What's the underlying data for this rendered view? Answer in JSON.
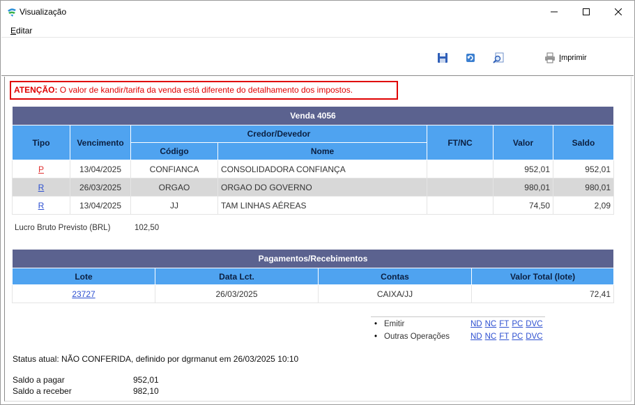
{
  "window": {
    "title": "Visualização"
  },
  "menu": {
    "edit": {
      "mnemonic": "E",
      "rest": "ditar"
    }
  },
  "toolbar": {
    "print": {
      "mnemonic": "I",
      "rest": "mprimir"
    }
  },
  "alert": {
    "bold": "ATENÇÃO:",
    "text": " O valor de kandir/tarifa da venda está diferente do detalhamento dos impostos."
  },
  "sale": {
    "title": "Venda  4056",
    "headers": {
      "tipo": "Tipo",
      "vencimento": "Vencimento",
      "credor": "Credor/Devedor",
      "codigo": "Código",
      "nome": "Nome",
      "ftnc": "FT/NC",
      "valor": "Valor",
      "saldo": "Saldo"
    },
    "rows": [
      {
        "tipo": "P",
        "vencimento": "13/04/2025",
        "codigo": "CONFIANCA",
        "nome": "CONSOLIDADORA CONFIANÇA",
        "ftnc": "",
        "valor": "952,01",
        "saldo": "952,01"
      },
      {
        "tipo": "R",
        "vencimento": "26/03/2025",
        "codigo": "ORGAO",
        "nome": "ORGAO DO GOVERNO",
        "ftnc": "",
        "valor": "980,01",
        "saldo": "980,01"
      },
      {
        "tipo": "R",
        "vencimento": "13/04/2025",
        "codigo": "JJ",
        "nome": "TAM LINHAS AÉREAS",
        "ftnc": "",
        "valor": "74,50",
        "saldo": "2,09"
      }
    ]
  },
  "lucro": {
    "label": "Lucro Bruto Previsto (BRL)",
    "value": "102,50"
  },
  "payments": {
    "title": "Pagamentos/Recebimentos",
    "headers": {
      "lote": "Lote",
      "data": "Data Lct.",
      "contas": "Contas",
      "valor": "Valor Total (lote)"
    },
    "rows": [
      {
        "lote": "23727",
        "data": "26/03/2025",
        "contas": "CAIXA/JJ",
        "valor": "72,41"
      }
    ]
  },
  "operations": {
    "bullet": "•",
    "emitir": {
      "label": "Emitir",
      "links": [
        "ND",
        "NC",
        "FT",
        "PC",
        "DVC"
      ]
    },
    "outras": {
      "label": "Outras Operações",
      "links": [
        "ND",
        "NC",
        "FT",
        "PC",
        "DVC"
      ]
    }
  },
  "status": {
    "text": "Status atual: NÃO CONFERIDA, definido por dgrmanut em 26/03/2025 10:10"
  },
  "saldo": {
    "pagar": {
      "label": "Saldo a pagar",
      "value": "952,01"
    },
    "receber": {
      "label": "Saldo a receber",
      "value": "982,10"
    }
  },
  "colors": {
    "header_dark": "#5b628f",
    "header_blue": "#4fa3f0",
    "alert_red": "#e00000",
    "link_blue": "#2d4fd0",
    "link_red": "#e03030"
  }
}
